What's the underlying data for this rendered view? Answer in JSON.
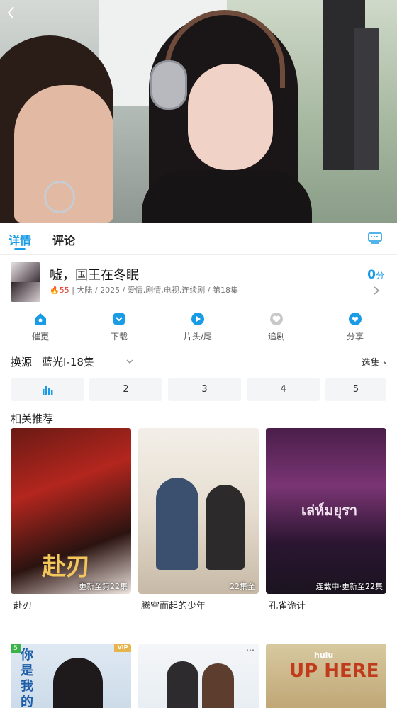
{
  "tabs": [
    {
      "label": "详情",
      "active": true
    },
    {
      "label": "评论",
      "active": false
    }
  ],
  "show": {
    "title": "嘘，国王在冬眠",
    "hot": "55",
    "meta": "大陆 / 2025 / 爱情,剧情,电视,连续剧 / 第18集",
    "score": "0",
    "score_unit": "分"
  },
  "actions": [
    {
      "label": "催更",
      "icon": "house-bell-icon"
    },
    {
      "label": "下载",
      "icon": "download-icon"
    },
    {
      "label": "片头/尾",
      "icon": "play-skip-icon"
    },
    {
      "label": "追剧",
      "icon": "heart-icon"
    },
    {
      "label": "分享",
      "icon": "share-icon"
    }
  ],
  "source": {
    "label": "换源",
    "value": "蓝光I-18集",
    "episode_select": "选集"
  },
  "episodes": [
    "",
    "2",
    "3",
    "4",
    "5"
  ],
  "related": {
    "title": "相关推荐",
    "items": [
      {
        "name": "赴刃",
        "badge": "更新至第22集",
        "overlay": "赴刃"
      },
      {
        "name": "腾空而起的少年",
        "badge": "22集全",
        "overlay": ""
      },
      {
        "name": "孔雀诡计",
        "badge": "连载中·更新至22集",
        "overlay": "เล่ห์มยุรา"
      }
    ],
    "row2": [
      {
        "tag": "5",
        "vip": "VIP",
        "overlay": "你是我的"
      },
      {
        "tag": "",
        "vip": "",
        "overlay": ""
      },
      {
        "tag": "",
        "vip": "",
        "overlay": "UP HERE",
        "brand": "hulu"
      }
    ]
  },
  "colors": {
    "accent": "#1a9be6",
    "hot": "#e53a2f"
  }
}
